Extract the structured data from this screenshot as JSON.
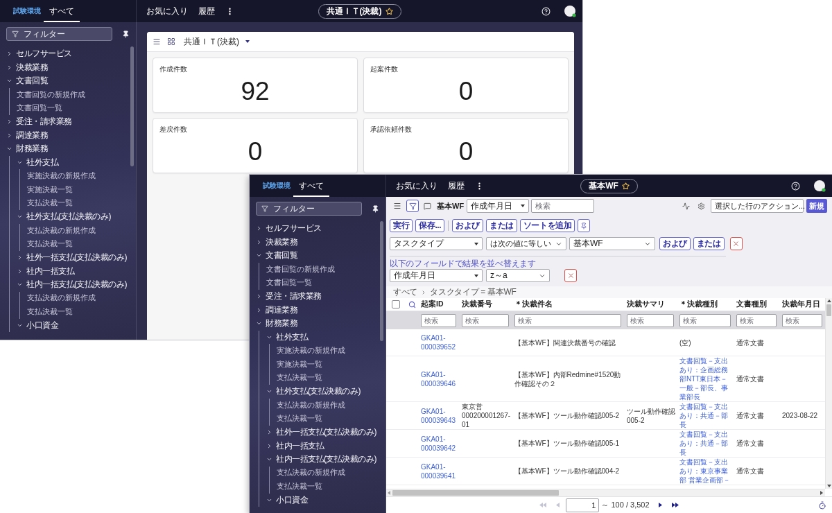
{
  "windows": [
    {
      "kind": "dashboard",
      "header": {
        "env_label": "試験環境",
        "tabs": [
          {
            "label": "すべて",
            "selected": true
          }
        ],
        "nav": [
          "お気に入り",
          "履歴"
        ],
        "title": "共通ＩＴ(決裁)",
        "starred": false
      },
      "sidebar": {
        "filter_placeholder": "フィルター",
        "items": [
          {
            "label": "セルフサービス",
            "kind": "folder",
            "expanded": false
          },
          {
            "label": "決裁業務",
            "kind": "folder",
            "expanded": false
          },
          {
            "label": "文書回覧",
            "kind": "folder",
            "expanded": true,
            "children": [
              {
                "label": "文書回覧の新規作成",
                "kind": "link"
              },
              {
                "label": "文書回覧一覧",
                "kind": "link"
              }
            ]
          },
          {
            "label": "受注・請求業務",
            "kind": "folder",
            "expanded": false
          },
          {
            "label": "調達業務",
            "kind": "folder",
            "expanded": false
          },
          {
            "label": "財務業務",
            "kind": "folder",
            "expanded": true,
            "children": [
              {
                "label": "社外支払",
                "kind": "folder",
                "expanded": true,
                "children": [
                  {
                    "label": "実施決裁の新規作成",
                    "kind": "link"
                  },
                  {
                    "label": "実施決裁一覧",
                    "kind": "link"
                  },
                  {
                    "label": "支払決裁一覧",
                    "kind": "link"
                  }
                ]
              },
              {
                "label": "社外支払(支払決裁のみ)",
                "kind": "folder",
                "expanded": true,
                "children": [
                  {
                    "label": "支払決裁の新規作成",
                    "kind": "link"
                  },
                  {
                    "label": "支払決裁一覧",
                    "kind": "link"
                  }
                ]
              },
              {
                "label": "社外一括支払(支払決裁のみ)",
                "kind": "folder",
                "expanded": false
              },
              {
                "label": "社内一括支払",
                "kind": "folder",
                "expanded": false
              },
              {
                "label": "社内一括支払(支払決裁のみ)",
                "kind": "folder",
                "expanded": true,
                "children": [
                  {
                    "label": "支払決裁の新規作成",
                    "kind": "link"
                  },
                  {
                    "label": "支払決裁一覧",
                    "kind": "link"
                  }
                ]
              },
              {
                "label": "小口資金",
                "kind": "folder",
                "expanded": true
              }
            ]
          }
        ]
      },
      "dashboard": {
        "title": "共通ＩＴ(決裁)",
        "cards": [
          {
            "label": "作成件数",
            "value": "92"
          },
          {
            "label": "起案件数",
            "value": "0"
          },
          {
            "label": "差戻件数",
            "value": "0"
          },
          {
            "label": "承認依頼件数",
            "value": "0"
          }
        ]
      }
    },
    {
      "kind": "list",
      "header": {
        "env_label": "試験環境",
        "tabs": [
          {
            "label": "すべて",
            "selected": true
          }
        ],
        "nav": [
          "お気に入り",
          "履歴"
        ],
        "title": "基本WF",
        "starred": false
      },
      "sidebar": {
        "filter_placeholder": "フィルター",
        "items": [
          {
            "label": "セルフサービス",
            "kind": "folder",
            "expanded": false
          },
          {
            "label": "決裁業務",
            "kind": "folder",
            "expanded": false
          },
          {
            "label": "文書回覧",
            "kind": "folder",
            "expanded": true,
            "children": [
              {
                "label": "文書回覧の新規作成",
                "kind": "link"
              },
              {
                "label": "文書回覧一覧",
                "kind": "link"
              }
            ]
          },
          {
            "label": "受注・請求業務",
            "kind": "folder",
            "expanded": false
          },
          {
            "label": "調達業務",
            "kind": "folder",
            "expanded": false
          },
          {
            "label": "財務業務",
            "kind": "folder",
            "expanded": true,
            "children": [
              {
                "label": "社外支払",
                "kind": "folder",
                "expanded": true,
                "children": [
                  {
                    "label": "実施決裁の新規作成",
                    "kind": "link"
                  },
                  {
                    "label": "実施決裁一覧",
                    "kind": "link"
                  },
                  {
                    "label": "支払決裁一覧",
                    "kind": "link"
                  }
                ]
              },
              {
                "label": "社外支払(支払決裁のみ)",
                "kind": "folder",
                "expanded": true,
                "children": [
                  {
                    "label": "支払決裁の新規作成",
                    "kind": "link"
                  },
                  {
                    "label": "支払決裁一覧",
                    "kind": "link"
                  }
                ]
              },
              {
                "label": "社外一括支払(支払決裁のみ)",
                "kind": "folder",
                "expanded": false
              },
              {
                "label": "社内一括支払",
                "kind": "folder",
                "expanded": false
              },
              {
                "label": "社内一括支払(支払決裁のみ)",
                "kind": "folder",
                "expanded": true,
                "children": [
                  {
                    "label": "支払決裁の新規作成",
                    "kind": "link"
                  },
                  {
                    "label": "支払決裁一覧",
                    "kind": "link"
                  }
                ]
              },
              {
                "label": "小口資金",
                "kind": "folder",
                "expanded": true
              }
            ]
          }
        ]
      },
      "list": {
        "toolbar": {
          "filter_active": true,
          "title": "基本WF",
          "field": "作成年月日",
          "search_placeholder": "検索",
          "action_select": "選択した行のアクション...",
          "new_button": "新規"
        },
        "button_groups": [
          [
            "実行",
            "保存..."
          ],
          [
            "および",
            "または",
            "ソートを追加"
          ]
        ],
        "condition": {
          "field": "タスクタイプ",
          "operator": "は次の値に等しい",
          "value": "基本WF",
          "buttons": [
            "および",
            "または"
          ]
        },
        "sort": {
          "caption": "以下のフィールドで結果を並べ替えます",
          "field": "作成年月日",
          "order": "z～a"
        },
        "breadcrumb": [
          "すべて",
          "タスクタイプ = 基本WF"
        ],
        "table": {
          "select_all_checked": false,
          "columns": [
            {
              "label": "起案ID",
              "filter_placeholder": "検索",
              "link": true
            },
            {
              "label": "決裁番号",
              "filter_placeholder": "検索"
            },
            {
              "label": "＊決裁件名",
              "filter_placeholder": "検索"
            },
            {
              "label": "決裁サマリ",
              "filter_placeholder": "検索"
            },
            {
              "label": "＊決裁種別",
              "filter_placeholder": "検索"
            },
            {
              "label": "文書種別",
              "filter_placeholder": "検索"
            },
            {
              "label": "決裁年月日",
              "filter_placeholder": "検索"
            }
          ],
          "rows": [
            {
              "cells": [
                "GKA01-000039652",
                null,
                "【基本WF】関連決裁番号の確認",
                null,
                {
                  "text": "(空)",
                  "link": false
                },
                "通常文書",
                null
              ]
            },
            {
              "cells": [
                "GKA01-000039646",
                null,
                "【基本WF】内部Redmine#1520動作確認その２",
                null,
                {
                  "text": "文書回覧－支出あり：企画総務部NTT東日本－一般－部長、事業部長",
                  "link": true
                },
                "通常文書",
                null
              ]
            },
            {
              "cells": [
                "GKA01-000039643",
                "東京営000200001267-01",
                "【基本WF】ツール動作確認005-2",
                "ツール動作確認005-2",
                {
                  "text": "文書回覧－支出あり：共通－部長",
                  "link": true
                },
                "通常文書",
                "2023-08-22"
              ]
            },
            {
              "cells": [
                "GKA01-000039642",
                null,
                "【基本WF】ツール動作確認005-1",
                null,
                {
                  "text": "文書回覧－支出あり：共通－部長",
                  "link": true
                },
                "通常文書",
                null
              ]
            },
            {
              "cells": [
                "GKA01-000039641",
                null,
                "【基本WF】ツール動作確認004-2",
                null,
                {
                  "text": "文書回覧－支出あり：東京事業部 営業企画部－",
                  "link": true
                },
                "通常文書",
                null
              ]
            }
          ]
        },
        "pagination": {
          "page": "1",
          "range": "～ 100 / 3,502",
          "first_disabled": true,
          "prev_disabled": true,
          "next_disabled": false,
          "last_disabled": false
        }
      }
    }
  ]
}
